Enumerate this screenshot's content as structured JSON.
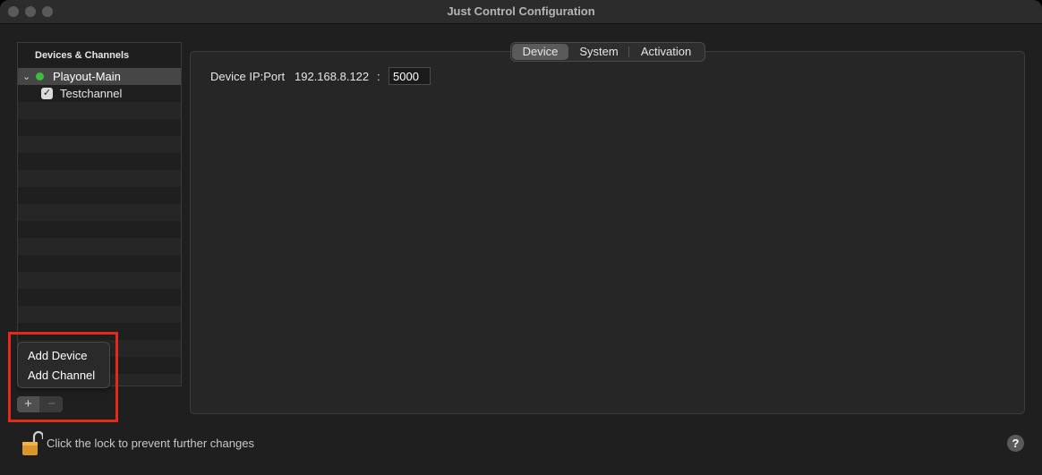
{
  "window": {
    "title": "Just Control Configuration"
  },
  "sidebar": {
    "header": "Devices & Channels",
    "device": {
      "label": "Playout-Main",
      "status_color": "#3dbd3d"
    },
    "channel": {
      "label": "Testchannel",
      "checked": true
    }
  },
  "context_menu": {
    "items": [
      "Add Device",
      "Add Channel"
    ]
  },
  "buttons": {
    "add": "+",
    "remove": "−"
  },
  "tabs": [
    {
      "label": "Device",
      "selected": true
    },
    {
      "label": "System",
      "selected": false
    },
    {
      "label": "Activation",
      "selected": false
    }
  ],
  "device_settings": {
    "ip_label": "Device IP:Port",
    "ip_value": "192.168.8.122",
    "separator": ":",
    "port_value": "5000"
  },
  "footer": {
    "lock_text": "Click the lock to prevent further changes",
    "help_symbol": "?"
  },
  "colors": {
    "highlight": "#e32a1d"
  }
}
